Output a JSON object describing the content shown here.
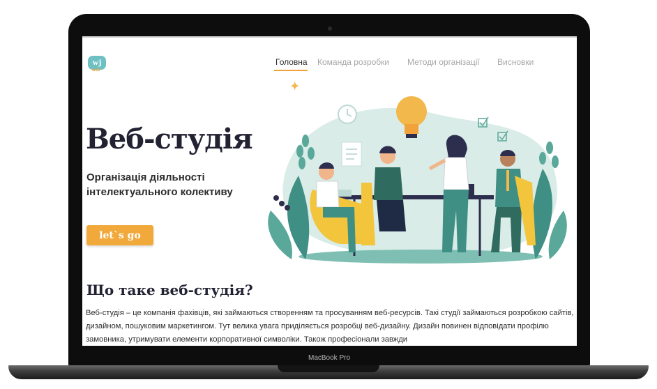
{
  "logo": {
    "letters": "wj",
    "sub": "web"
  },
  "nav": {
    "items": [
      "Головна",
      "Команда розробки",
      "Методи організації",
      "Висновки"
    ],
    "active_index": 0
  },
  "hero": {
    "title": "Веб-студія",
    "subtitle": "Організація діяльності інтелектуального колективу",
    "cta": "let`s go"
  },
  "section": {
    "title": "Що таке веб-студія?",
    "paragraph": "Веб-студія – це компанія фахівців, які займаються створенням та просуванням веб-ресурсів. Такі студії займаються розробкою сайтів, дизайном, пошуковим маркетингом. Тут велика увага приділяється розробці веб-дизайну. Дизайн повинен відповідати профілю замовника, утримувати елементи корпоративної символіки. Також професіонали завжди"
  },
  "device": {
    "label": "MacBook Pro"
  },
  "colors": {
    "accent": "#f2a93b",
    "teal": "#3f8f84",
    "logo": "#6fc0c2"
  },
  "icons": [
    "lightbulb-icon",
    "clock-icon",
    "checkbox-icon",
    "document-icon"
  ]
}
